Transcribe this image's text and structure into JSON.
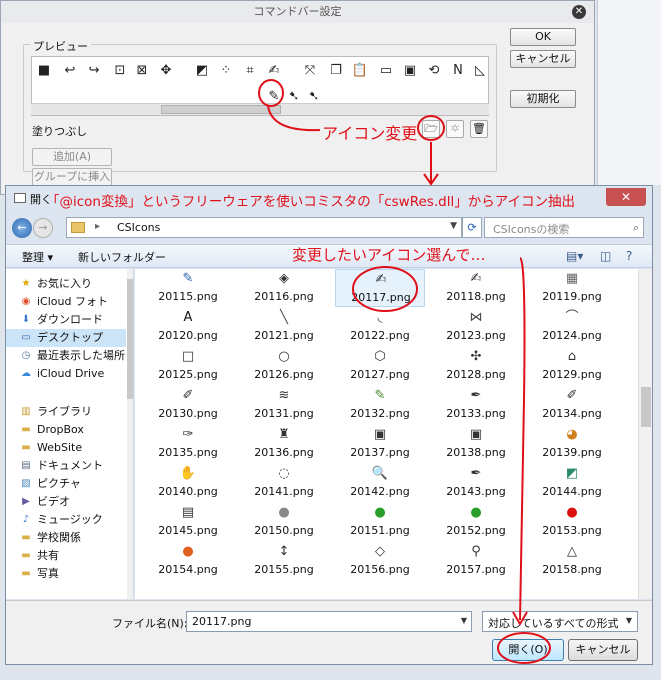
{
  "cmd_dialog": {
    "title": "コマンドバー設定",
    "preview_label": "プレビュー",
    "ok_label": "OK",
    "cancel_label": "キャンセル",
    "init_label": "初期化",
    "fill_label": "塗りつぶし",
    "add_label": "追加(A)",
    "group_insert_label": "グループに挿入(I)"
  },
  "file_dialog": {
    "title": "開く",
    "address": "CSIcons",
    "search_placeholder": "CSIconsの検索",
    "organize_label": "整理 ▾",
    "new_folder_label": "新しいフォルダー",
    "nav_items": [
      {
        "label": "お気に入り",
        "icon": "star-icon"
      },
      {
        "label": "iCloud フォト",
        "icon": "photo-icon"
      },
      {
        "label": "ダウンロード",
        "icon": "download-icon"
      },
      {
        "label": "デスクトップ",
        "icon": "desktop-icon"
      },
      {
        "label": "最近表示した場所",
        "icon": "recent-icon"
      },
      {
        "label": "iCloud Drive",
        "icon": "cloud-icon"
      },
      {
        "label": "ライブラリ",
        "icon": "library-icon"
      },
      {
        "label": "DropBox",
        "icon": "folder-icon"
      },
      {
        "label": "WebSite",
        "icon": "folder-icon"
      },
      {
        "label": "ドキュメント",
        "icon": "document-icon"
      },
      {
        "label": "ピクチャ",
        "icon": "picture-icon"
      },
      {
        "label": "ビデオ",
        "icon": "video-icon"
      },
      {
        "label": "ミュージック",
        "icon": "music-icon"
      },
      {
        "label": "学校関係",
        "icon": "folder-icon"
      },
      {
        "label": "共有",
        "icon": "folder-icon"
      },
      {
        "label": "写真",
        "icon": "folder-icon"
      }
    ],
    "files": [
      {
        "name": "20115.png",
        "icon": "✎",
        "color": "#2a5db0"
      },
      {
        "name": "20116.png",
        "icon": "◈",
        "color": "#333333"
      },
      {
        "name": "20117.png",
        "icon": "✍",
        "color": "#333333"
      },
      {
        "name": "20118.png",
        "icon": "✍",
        "color": "#333333"
      },
      {
        "name": "20119.png",
        "icon": "▦",
        "color": "#666666"
      },
      {
        "name": "20120.png",
        "icon": "A",
        "color": "#111111"
      },
      {
        "name": "20121.png",
        "icon": "╲",
        "color": "#444444"
      },
      {
        "name": "20122.png",
        "icon": "◟",
        "color": "#444444"
      },
      {
        "name": "20123.png",
        "icon": "⋈",
        "color": "#444444"
      },
      {
        "name": "20124.png",
        "icon": "⌒",
        "color": "#444444"
      },
      {
        "name": "20125.png",
        "icon": "□",
        "color": "#333333"
      },
      {
        "name": "20126.png",
        "icon": "○",
        "color": "#333333"
      },
      {
        "name": "20127.png",
        "icon": "⬡",
        "color": "#333333"
      },
      {
        "name": "20128.png",
        "icon": "✣",
        "color": "#333333"
      },
      {
        "name": "20129.png",
        "icon": "⌂",
        "color": "#333333"
      },
      {
        "name": "20130.png",
        "icon": "✐",
        "color": "#333333"
      },
      {
        "name": "20131.png",
        "icon": "≋",
        "color": "#333333"
      },
      {
        "name": "20132.png",
        "icon": "✎",
        "color": "#4a8a2a"
      },
      {
        "name": "20133.png",
        "icon": "✒",
        "color": "#333333"
      },
      {
        "name": "20134.png",
        "icon": "✐",
        "color": "#333333"
      },
      {
        "name": "20135.png",
        "icon": "✑",
        "color": "#333333"
      },
      {
        "name": "20136.png",
        "icon": "♜",
        "color": "#333333"
      },
      {
        "name": "20137.png",
        "icon": "▣",
        "color": "#333333"
      },
      {
        "name": "20138.png",
        "icon": "▣",
        "color": "#333333"
      },
      {
        "name": "20139.png",
        "icon": "◕",
        "color": "#d08020"
      },
      {
        "name": "20140.png",
        "icon": "✋",
        "color": "#333333"
      },
      {
        "name": "20141.png",
        "icon": "◌",
        "color": "#333333"
      },
      {
        "name": "20142.png",
        "icon": "🔍",
        "color": "#333333"
      },
      {
        "name": "20143.png",
        "icon": "✒",
        "color": "#333333"
      },
      {
        "name": "20144.png",
        "icon": "◩",
        "color": "#2a8a6a"
      },
      {
        "name": "20145.png",
        "icon": "▤",
        "color": "#333333"
      },
      {
        "name": "20150.png",
        "icon": "●",
        "color": "#888888"
      },
      {
        "name": "20151.png",
        "icon": "●",
        "color": "#2aa02a"
      },
      {
        "name": "20152.png",
        "icon": "●",
        "color": "#2aa02a"
      },
      {
        "name": "20153.png",
        "icon": "●",
        "color": "#dd1010"
      },
      {
        "name": "20154.png",
        "icon": "●",
        "color": "#e06020"
      },
      {
        "name": "20155.png",
        "icon": "↕",
        "color": "#333333"
      },
      {
        "name": "20156.png",
        "icon": "◇",
        "color": "#333333"
      },
      {
        "name": "20157.png",
        "icon": "⚲",
        "color": "#333333"
      },
      {
        "name": "20158.png",
        "icon": "△",
        "color": "#333333"
      }
    ],
    "filename_label": "ファイル名(N):",
    "filename_value": "20117.png",
    "filetype_value": "対応しているすべての形式",
    "open_label": "開く(O)",
    "cancel_label": "キャンセル"
  },
  "annotations": {
    "top": "「@icon変換」というフリーウェアを使いコミスタの「cswRes.dll」からアイコン抽出",
    "icon_change": "アイコン変更",
    "select_icon": "変更したいアイコン選んで…",
    "color": "#e0101a"
  }
}
